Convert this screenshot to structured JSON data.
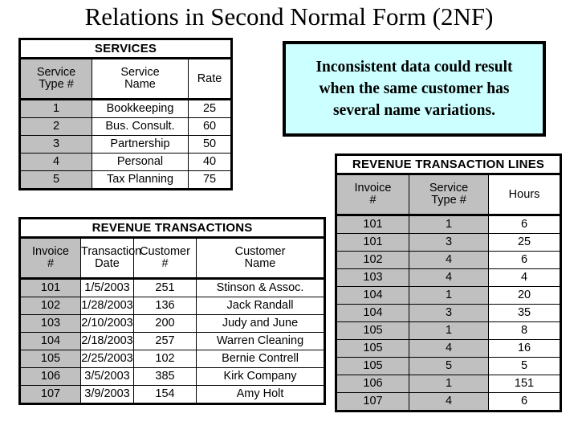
{
  "slide": {
    "title": "Relations in Second Normal Form (2NF)"
  },
  "colors": {
    "key_column_fill": "#C0C0C0",
    "callout_fill": "#CCFFFF",
    "border": "#000000",
    "text": "#000000",
    "table_fill": "#FFFFFF"
  },
  "callout": {
    "line1": "Inconsistent data could result",
    "line2": "when the same customer has",
    "line3": "several name variations."
  },
  "tables": {
    "services": {
      "title": "SERVICES",
      "headers": [
        {
          "line1": "Service",
          "line2": "Type #",
          "key": true
        },
        {
          "line1": "Service",
          "line2": "Name",
          "key": false
        },
        {
          "line1": "",
          "line2": "Rate",
          "key": false
        }
      ],
      "rows": [
        [
          "1",
          "Bookkeeping",
          "25"
        ],
        [
          "2",
          "Bus. Consult.",
          "60"
        ],
        [
          "3",
          "Partnership",
          "50"
        ],
        [
          "4",
          "Personal",
          "40"
        ],
        [
          "5",
          "Tax Planning",
          "75"
        ]
      ]
    },
    "revenue_transactions": {
      "title": "REVENUE TRANSACTIONS",
      "headers": [
        {
          "line1": "Invoice",
          "line2": "#",
          "key": true
        },
        {
          "line1": "Transaction",
          "line2": "Date",
          "key": false
        },
        {
          "line1": "Customer",
          "line2": "#",
          "key": false
        },
        {
          "line1": "Customer",
          "line2": "Name",
          "key": false
        }
      ],
      "rows": [
        [
          "101",
          "1/5/2003",
          "251",
          "Stinson & Assoc."
        ],
        [
          "102",
          "1/28/2003",
          "136",
          "Jack Randall"
        ],
        [
          "103",
          "2/10/2003",
          "200",
          "Judy and June"
        ],
        [
          "104",
          "2/18/2003",
          "257",
          "Warren Cleaning"
        ],
        [
          "105",
          "2/25/2003",
          "102",
          "Bernie Contrell"
        ],
        [
          "106",
          "3/5/2003",
          "385",
          "Kirk Company"
        ],
        [
          "107",
          "3/9/2003",
          "154",
          "Amy Holt"
        ]
      ]
    },
    "revenue_transaction_lines": {
      "title": "REVENUE TRANSACTION LINES",
      "headers": [
        {
          "line1": "Invoice",
          "line2": "#",
          "key": true
        },
        {
          "line1": "Service",
          "line2": "Type #",
          "key": true
        },
        {
          "line1": "",
          "line2": "Hours",
          "key": false
        }
      ],
      "rows": [
        [
          "101",
          "1",
          "6"
        ],
        [
          "101",
          "3",
          "25"
        ],
        [
          "102",
          "4",
          "6"
        ],
        [
          "103",
          "4",
          "4"
        ],
        [
          "104",
          "1",
          "20"
        ],
        [
          "104",
          "3",
          "35"
        ],
        [
          "105",
          "1",
          "8"
        ],
        [
          "105",
          "4",
          "16"
        ],
        [
          "105",
          "5",
          "5"
        ],
        [
          "106",
          "1",
          "151"
        ],
        [
          "107",
          "4",
          "6"
        ]
      ]
    }
  }
}
